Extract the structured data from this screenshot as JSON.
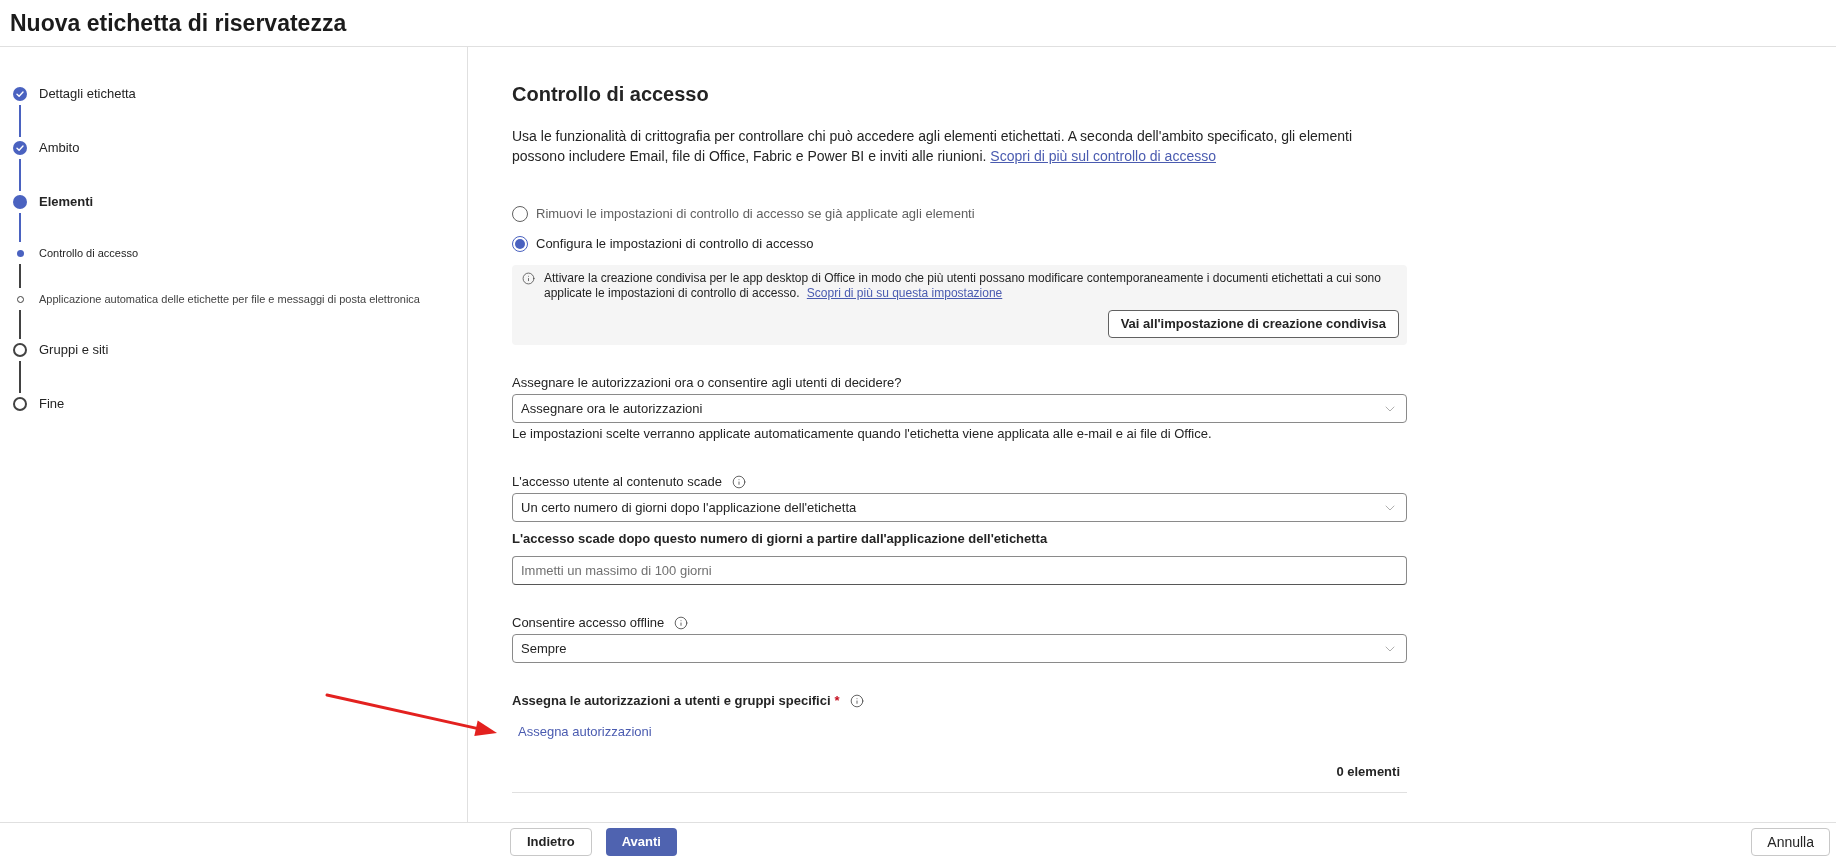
{
  "header": {
    "title": "Nuova etichetta di riservatezza"
  },
  "steps": [
    {
      "label": "Dettagli etichetta",
      "completed": true,
      "current": false
    },
    {
      "label": "Ambito",
      "completed": true,
      "current": false
    },
    {
      "label": "Elementi",
      "completed": false,
      "current": true,
      "children": [
        {
          "label": "Controllo di accesso",
          "completed": false,
          "current": true
        },
        {
          "label": "Applicazione automatica delle etichette per file e messaggi di posta elettronica",
          "completed": false,
          "current": false
        }
      ]
    },
    {
      "label": "Gruppi e siti",
      "completed": false,
      "current": false
    },
    {
      "label": "Fine",
      "completed": false,
      "current": false
    }
  ],
  "content": {
    "title": "Controllo di accesso",
    "description": "Usa le funzionalità di crittografia per controllare chi può accedere agli elementi etichettati. A seconda dell'ambito specificato, gli elementi possono includere Email, file di Office, Fabric e Power BI e inviti alle riunioni.",
    "description_link": "Scopri di più sul controllo di accesso",
    "radios": [
      {
        "label": "Rimuovi le impostazioni di controllo di accesso se già applicate agli elementi",
        "selected": false
      },
      {
        "label": "Configura le impostazioni di controllo di accesso",
        "selected": true
      }
    ],
    "info_box": {
      "text": "Attivare la creazione condivisa per le app desktop di Office in modo che più utenti possano modificare contemporaneamente i documenti etichettati a cui sono applicate le impostazioni di controllo di accesso.",
      "link": "Scopri di più su questa impostazione",
      "button": "Vai all'impostazione di creazione condivisa"
    },
    "fields": [
      {
        "kind": "dropdown",
        "label": "Assegnare le autorizzazioni ora o consentire agli utenti di decidere?",
        "value": "Assegnare ora le autorizzazioni",
        "help": "Le impostazioni scelte verranno applicate automaticamente quando l'etichetta viene applicata alle e-mail e ai file di Office."
      },
      {
        "kind": "dropdown",
        "label": "L'accesso utente al contenuto scade",
        "info": true,
        "value": "Un certo numero di giorni dopo l'applicazione dell'etichetta"
      },
      {
        "kind": "input",
        "label": "L'accesso scade dopo questo numero di giorni a partire dall'applicazione dell'etichetta",
        "placeholder": "Immetti un massimo di 100 giorni"
      },
      {
        "kind": "dropdown",
        "label": "Consentire accesso offline",
        "info": true,
        "value": "Sempre"
      }
    ],
    "assign": {
      "label": "Assegna le autorizzazioni a utenti e gruppi specifici",
      "required_mark": "*",
      "info": true,
      "link": "Assegna autorizzazioni",
      "count": "0 elementi"
    }
  },
  "footer": {
    "buttons": [
      {
        "label": "Indietro",
        "kind": "secondary"
      },
      {
        "label": "Avanti",
        "kind": "primary"
      }
    ],
    "cancel": "Annulla"
  },
  "annotations": [
    {
      "kind": "arrow"
    }
  ]
}
